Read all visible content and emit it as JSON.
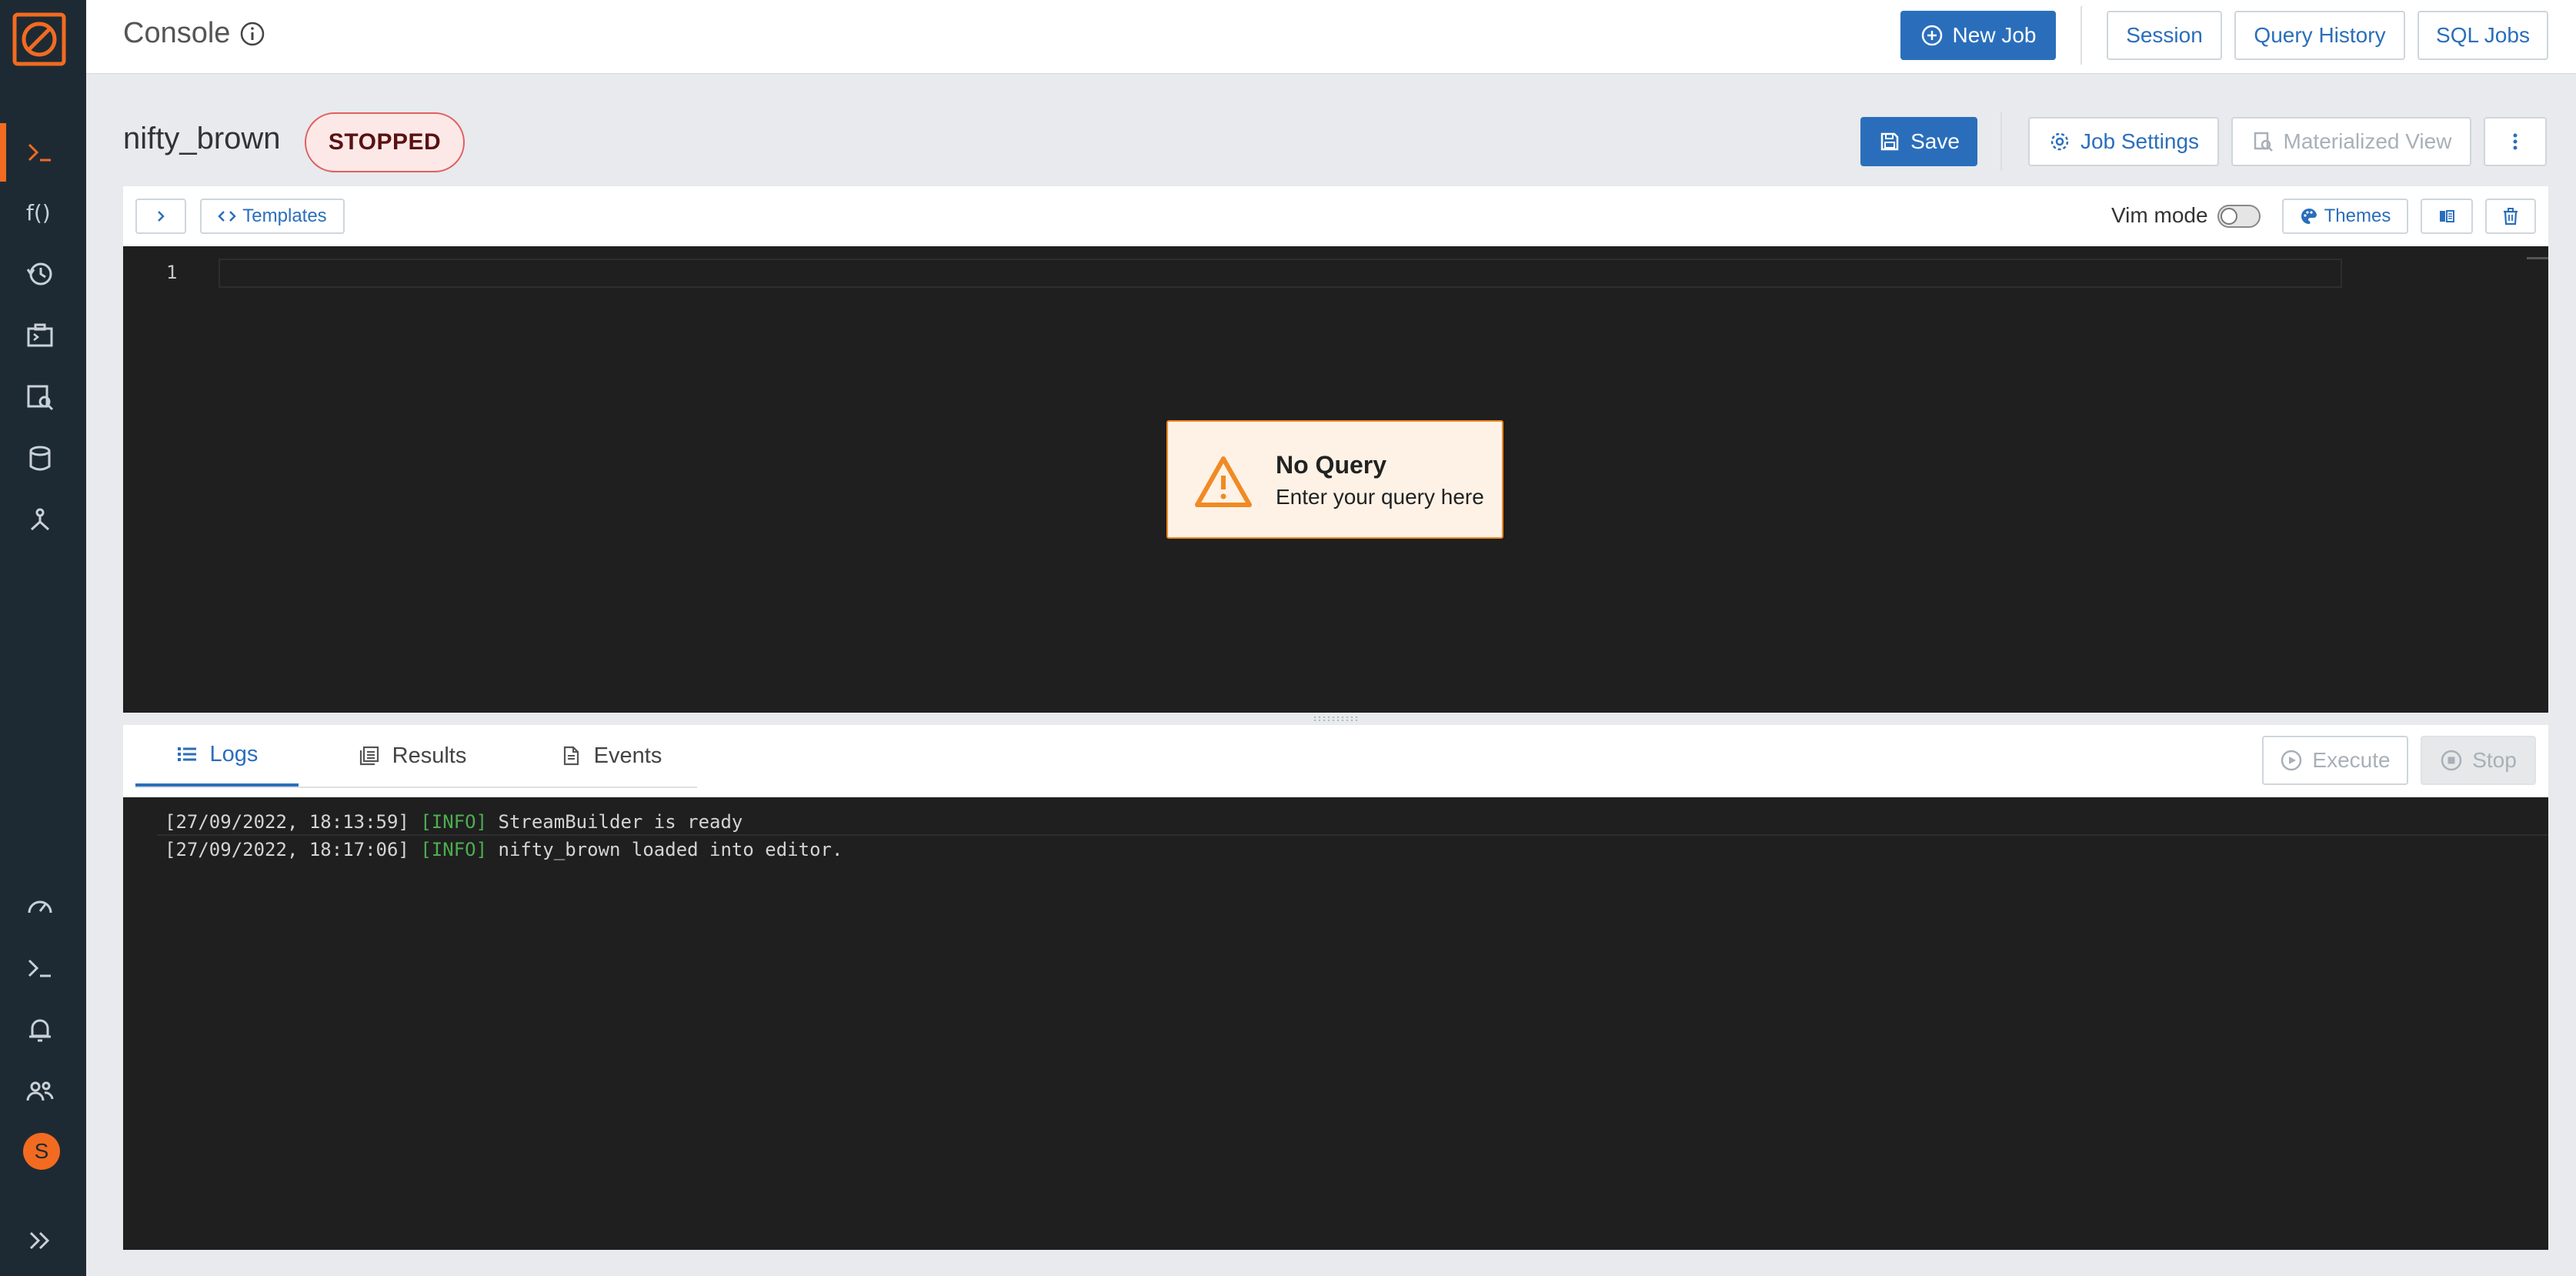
{
  "header": {
    "title": "Console",
    "new_job_label": "New Job",
    "session_label": "Session",
    "query_history_label": "Query History",
    "sql_jobs_label": "SQL Jobs"
  },
  "job": {
    "name": "nifty_brown",
    "status": "STOPPED",
    "save_label": "Save",
    "job_settings_label": "Job Settings",
    "materialized_view_label": "Materialized View"
  },
  "editor_toolbar": {
    "templates_label": "Templates",
    "vim_mode_label": "Vim mode",
    "themes_label": "Themes"
  },
  "editor": {
    "line_number": "1",
    "warning_title": "No Query",
    "warning_text": "Enter your query here"
  },
  "bottom": {
    "tabs": [
      "Logs",
      "Results",
      "Events"
    ],
    "execute_label": "Execute",
    "stop_label": "Stop",
    "logs": [
      {
        "time": "[27/09/2022, 18:13:59]",
        "level": "[INFO]",
        "message": "StreamBuilder is ready"
      },
      {
        "time": "[27/09/2022, 18:17:06]",
        "level": "[INFO]",
        "message": "nifty_brown loaded into editor."
      }
    ]
  },
  "user": {
    "initial": "S"
  },
  "colors": {
    "accent": "#2a6ebb",
    "brand": "#f26b21",
    "sidebar": "#1e2a33",
    "editor_bg": "#1f1f1f"
  },
  "icons": {
    "sidebar": [
      "console-icon",
      "functions-icon",
      "history-icon",
      "jobs-icon",
      "data-search-icon",
      "materialized-view-icon",
      "connectors-icon",
      "dashboard-icon",
      "terminal-icon",
      "notifications-icon",
      "users-icon",
      "expand-icon"
    ]
  }
}
